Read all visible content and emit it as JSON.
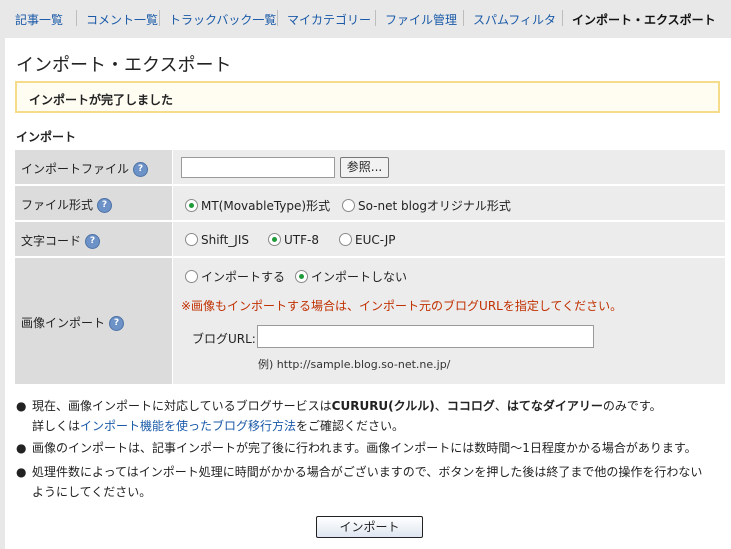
{
  "tabs": [
    {
      "label": "記事一覧"
    },
    {
      "label": "コメント一覧"
    },
    {
      "label": "トラックバック一覧"
    },
    {
      "label": "マイカテゴリー"
    },
    {
      "label": "ファイル管理"
    },
    {
      "label": "スパムフィルタ"
    },
    {
      "label": "インポート・エクスポート",
      "active": true
    }
  ],
  "page_title": "インポート・エクスポート",
  "notice": "インポートが完了しました",
  "section_heading": "インポート",
  "help_glyph": "?",
  "form": {
    "file": {
      "label": "インポートファイル",
      "browse_label": "参照...",
      "value": ""
    },
    "format": {
      "label": "ファイル形式",
      "options": [
        "MT(MovableType)形式",
        "So-net blogオリジナル形式"
      ],
      "selected": "MT(MovableType)形式"
    },
    "encoding": {
      "label": "文字コード",
      "options": [
        "Shift_JIS",
        "UTF-8",
        "EUC-JP"
      ],
      "selected": "UTF-8"
    },
    "image": {
      "label": "画像インポート",
      "options": [
        "インポートする",
        "インポートしない"
      ],
      "selected": "インポートしない",
      "warning": "※画像もインポートする場合は、インポート元のブログURLを指定してください。",
      "blog_url_label": "ブログURL:",
      "blog_url_value": "",
      "example": "例) http://sample.blog.so-net.ne.jp/"
    }
  },
  "notes": {
    "bullet": "●",
    "n1": {
      "p1": "現在、画像インポートに対応しているブログサービスは",
      "s1": "CURURU(クルル)",
      "p2": "、",
      "s2": "ココログ",
      "p3": "、",
      "s3": "はてなダイアリー",
      "p4": "のみです。",
      "p5": "詳しくは",
      "link": "インポート機能を使ったブログ移行方法",
      "p6": "をご確認ください。"
    },
    "n2": "画像のインポートは、記事インポートが完了後に行われます。画像インポートには数時間〜1日程度かかる場合があります。",
    "n3": "処理件数によってはインポート処理に時間がかかる場合がございますので、ボタンを押した後は終了まで他の操作を行わないようにしてください。"
  },
  "submit_label": "インポート"
}
